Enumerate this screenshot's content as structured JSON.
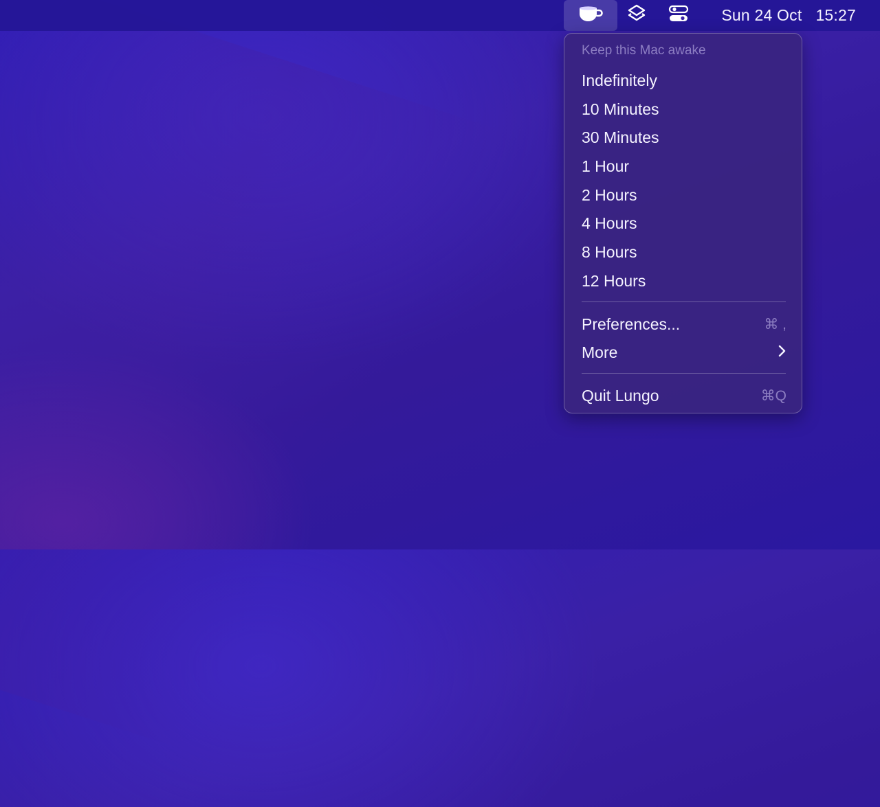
{
  "menubar": {
    "status_items": [
      {
        "name": "coffee-cup-icon"
      },
      {
        "name": "shortcuts-layers-icon"
      },
      {
        "name": "control-center-toggle-icon"
      }
    ],
    "clock": {
      "date": "Sun 24 Oct",
      "time": "15:27"
    }
  },
  "menu": {
    "header": "Keep this Mac awake",
    "durations": [
      "Indefinitely",
      "10 Minutes",
      "30 Minutes",
      "1 Hour",
      "2 Hours",
      "4 Hours",
      "8 Hours",
      "12 Hours"
    ],
    "preferences": {
      "label": "Preferences...",
      "shortcut": "⌘ ,"
    },
    "more": {
      "label": "More",
      "icon": "chevron-right-icon"
    },
    "quit": {
      "label": "Quit Lungo",
      "shortcut": "⌘Q"
    }
  },
  "colors": {
    "accent": "#3a20a6",
    "menu_bg": "#3a2480"
  }
}
